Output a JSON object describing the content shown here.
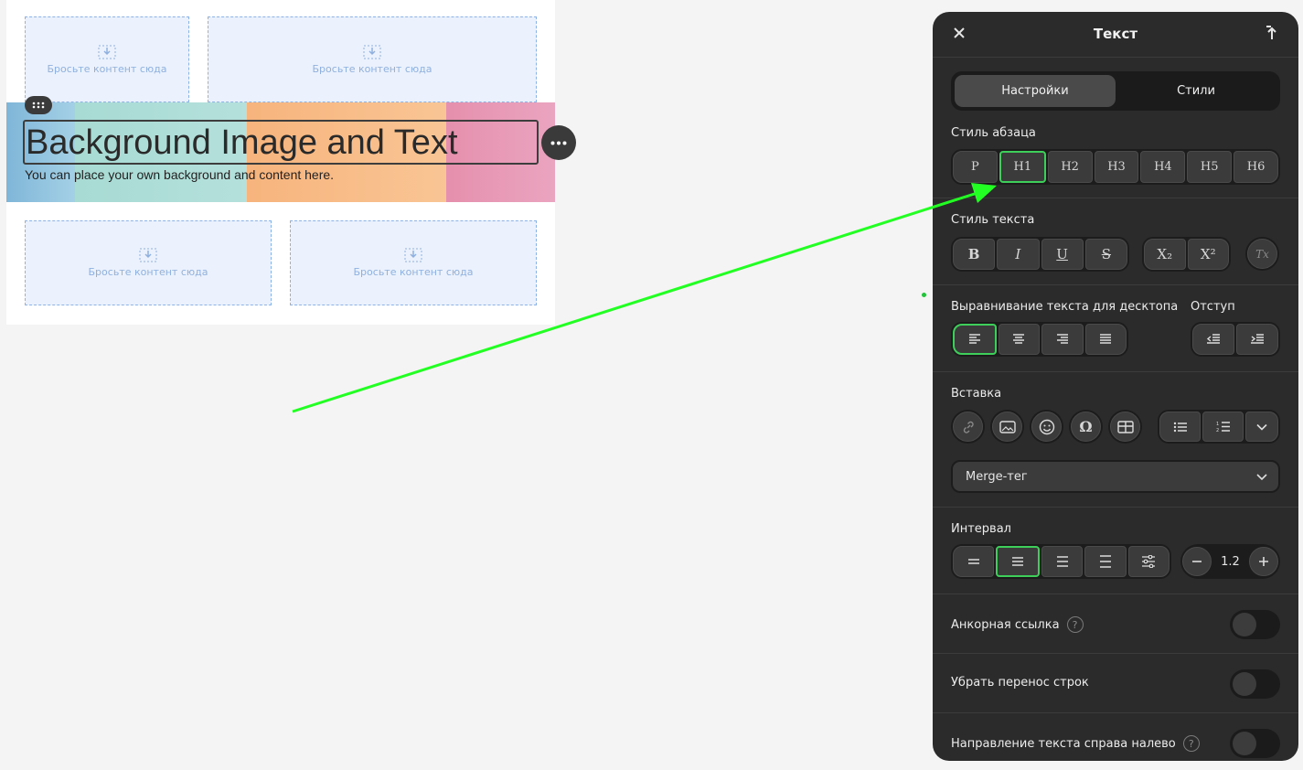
{
  "canvas": {
    "drop_label": "Бросьте контент сюда",
    "heading": "Background Image and Text",
    "subtext": "You can place your own background and content here."
  },
  "colors": {
    "accent": "#3ecf5a",
    "arrow": "#22ff22",
    "panel_bg": "#2b2b2b",
    "drop_bg": "#ebf2fd",
    "banner": [
      "#8fc2dd",
      "#a7dbd3",
      "#f6b884",
      "#e59bb4"
    ]
  },
  "panel": {
    "title": "Текст",
    "tabs": [
      {
        "label": "Настройки",
        "active": true
      },
      {
        "label": "Стили",
        "active": false
      }
    ],
    "paragraph_style": {
      "label": "Стиль абзаца",
      "options": [
        "P",
        "H1",
        "H2",
        "H3",
        "H4",
        "H5",
        "H6"
      ],
      "selected": "H1"
    },
    "text_style": {
      "label": "Стиль текста",
      "options": [
        "B",
        "I",
        "U",
        "S"
      ],
      "script_options": [
        "X₂",
        "X²"
      ],
      "clear": "Tx"
    },
    "alignment": {
      "label": "Выравнивание текста для десктопа",
      "selected": "left"
    },
    "indent": {
      "label": "Отступ"
    },
    "insert": {
      "label": "Вставка",
      "merge_tag": "Merge-тег"
    },
    "spacing": {
      "label": "Интервал",
      "value": "1.2",
      "selected_index": 1
    },
    "anchor_link": {
      "label": "Анкорная ссылка",
      "on": false
    },
    "remove_wrap": {
      "label": "Убрать перенос строк",
      "on": false
    },
    "rtl": {
      "label": "Направление текста справа налево",
      "on": false
    },
    "icons": {
      "close": "close-icon",
      "pin": "pin-icon",
      "link": "link-icon",
      "image": "image-icon",
      "emoji": "emoji-icon",
      "omega": "special-char-icon",
      "table": "table-icon",
      "bullets": "bulleted-list-icon",
      "numbers": "numbered-list-icon",
      "more": "chevron-down-icon"
    }
  }
}
